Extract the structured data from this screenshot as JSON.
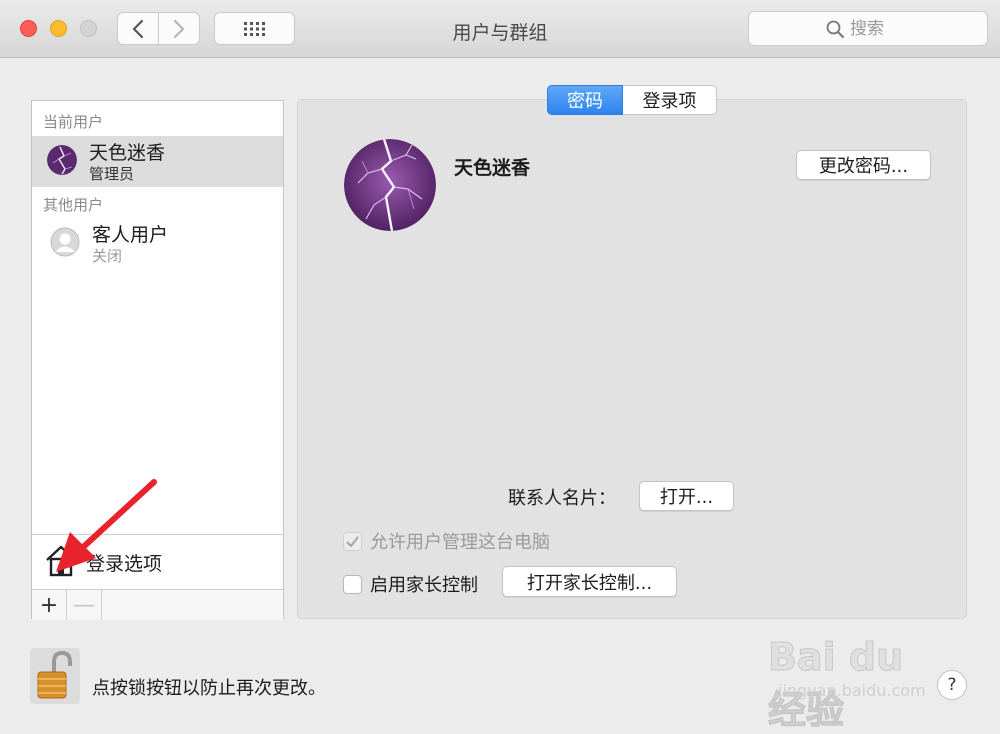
{
  "window": {
    "title": "用户与群组"
  },
  "toolbar": {
    "search_placeholder": "搜索"
  },
  "sidebar": {
    "current_user_label": "当前用户",
    "other_users_label": "其他用户",
    "users": [
      {
        "name": "天色迷香",
        "role": "管理员",
        "selected": true
      },
      {
        "name": "客人用户",
        "role": "关闭",
        "selected": false
      }
    ],
    "login_options": "登录选项",
    "add_symbol": "+",
    "remove_symbol": "—"
  },
  "tabs": [
    {
      "label": "密码",
      "active": true
    },
    {
      "label": "登录项",
      "active": false
    }
  ],
  "detail": {
    "user_name": "天色迷香",
    "change_password_button": "更改密码...",
    "contact_card_label": "联系人名片：",
    "open_button": "打开...",
    "allow_admin_label": "允许用户管理这台电脑",
    "allow_admin_checked": true,
    "enable_parental_label": "启用家长控制",
    "enable_parental_checked": false,
    "open_parental_button": "打开家长控制..."
  },
  "footer": {
    "lock_text": "点按锁按钮以防止再次更改。",
    "help_symbol": "?"
  },
  "watermark": {
    "brand": "Bai du 经验",
    "url": "jingyan.baidu.com"
  },
  "colors": {
    "accent": "#2d84ef",
    "arrow": "#e8232d"
  }
}
